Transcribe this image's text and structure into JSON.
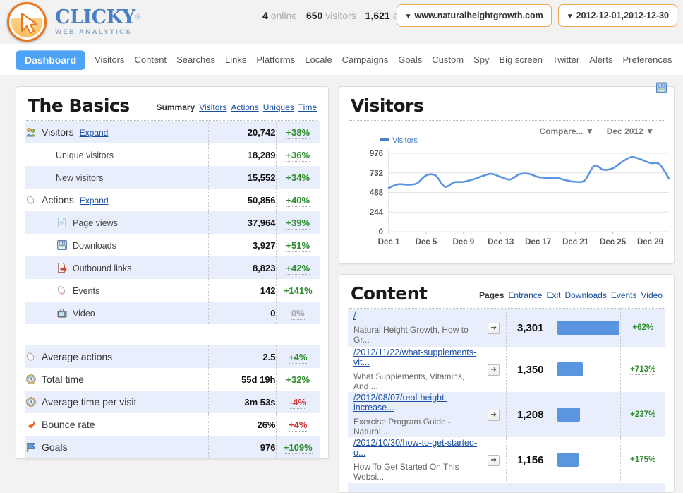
{
  "brand": {
    "name": "CLICKY",
    "reg": "®",
    "tagline": "WEB ANALYTICS",
    "logo_icon": "cursor-arrow-icon"
  },
  "header": {
    "online_count": "4",
    "online_label": "online",
    "visitors_count": "650",
    "visitors_label": "visitors",
    "actions_count": "1,621",
    "actions_label": "actions",
    "site_picker": "www.naturalheightgrowth.com",
    "date_picker": "2012-12-01,2012-12-30",
    "caret": "▼"
  },
  "nav": {
    "items": [
      {
        "label": "Dashboard",
        "active": true
      },
      {
        "label": "Visitors",
        "active": false
      },
      {
        "label": "Content",
        "active": false
      },
      {
        "label": "Searches",
        "active": false
      },
      {
        "label": "Links",
        "active": false
      },
      {
        "label": "Platforms",
        "active": false
      },
      {
        "label": "Locale",
        "active": false
      },
      {
        "label": "Campaigns",
        "active": false
      },
      {
        "label": "Goals",
        "active": false
      },
      {
        "label": "Custom",
        "active": false
      },
      {
        "label": "Spy",
        "active": false
      },
      {
        "label": "Big screen",
        "active": false
      },
      {
        "label": "Twitter",
        "active": false
      },
      {
        "label": "Alerts",
        "active": false
      },
      {
        "label": "Preferences",
        "active": false
      }
    ]
  },
  "basics": {
    "title": "The Basics",
    "tabs": [
      {
        "label": "Summary",
        "active": true
      },
      {
        "label": "Visitors",
        "active": false
      },
      {
        "label": "Actions",
        "active": false
      },
      {
        "label": "Uniques",
        "active": false
      },
      {
        "label": "Time",
        "active": false
      }
    ],
    "rows": [
      {
        "icon": "visitors-icon",
        "label": "Visitors",
        "expand": "Expand",
        "value": "20,742",
        "change": "+38%",
        "dir": "up",
        "indent": false,
        "alt": true
      },
      {
        "icon": "",
        "label": "Unique visitors",
        "expand": "",
        "value": "18,289",
        "change": "+36%",
        "dir": "up",
        "indent": true,
        "alt": false
      },
      {
        "icon": "",
        "label": "New visitors",
        "expand": "",
        "value": "15,552",
        "change": "+34%",
        "dir": "up",
        "indent": true,
        "alt": true
      },
      {
        "icon": "mouse-icon",
        "label": "Actions",
        "expand": "Expand",
        "value": "50,856",
        "change": "+40%",
        "dir": "up",
        "indent": false,
        "alt": false
      },
      {
        "icon": "page-icon",
        "label": "Page views",
        "expand": "",
        "value": "37,964",
        "change": "+39%",
        "dir": "up",
        "indent": true,
        "alt": true
      },
      {
        "icon": "floppy-icon",
        "label": "Downloads",
        "expand": "",
        "value": "3,927",
        "change": "+51%",
        "dir": "up",
        "indent": true,
        "alt": false
      },
      {
        "icon": "outbound-icon",
        "label": "Outbound links",
        "expand": "",
        "value": "8,823",
        "change": "+42%",
        "dir": "up",
        "indent": true,
        "alt": true
      },
      {
        "icon": "mouse-icon",
        "label": "Events",
        "expand": "",
        "value": "142",
        "change": "+141%",
        "dir": "up",
        "indent": true,
        "alt": false
      },
      {
        "icon": "tv-icon",
        "label": "Video",
        "expand": "",
        "value": "0",
        "change": "0%",
        "dir": "zero",
        "indent": true,
        "alt": true
      }
    ],
    "rows2": [
      {
        "icon": "mouse-icon",
        "label": "Average actions",
        "value": "2.5",
        "change": "+4%",
        "dir": "up",
        "alt": true
      },
      {
        "icon": "clock-icon",
        "label": "Total time",
        "value": "55d 19h",
        "change": "+32%",
        "dir": "up",
        "alt": false
      },
      {
        "icon": "clock-icon",
        "label": "Average time per visit",
        "value": "3m 53s",
        "change": "-4%",
        "dir": "down",
        "alt": true
      },
      {
        "icon": "bounce-icon",
        "label": "Bounce rate",
        "value": "26%",
        "change": "+4%",
        "dir": "down",
        "alt": false
      },
      {
        "icon": "flag-icon",
        "label": "Goals",
        "value": "976",
        "change": "+109%",
        "dir": "up",
        "alt": true
      }
    ]
  },
  "visitors_panel": {
    "title": "Visitors",
    "compare_label": "Compare...",
    "month_label": "Dec 2012",
    "caret": "▼",
    "save_icon": "save-floppy-icon"
  },
  "chart_data": {
    "type": "line",
    "title": "Visitors",
    "legend": [
      "Visitors"
    ],
    "legend_position": "top-left",
    "color": "#5b95e0",
    "xlabel": "",
    "ylabel": "",
    "ylim": [
      0,
      976
    ],
    "yticks": [
      0,
      244,
      488,
      732,
      976
    ],
    "ytick_labels": [
      "0",
      "244",
      "488",
      "732",
      "976"
    ],
    "grid": true,
    "xtick_labels": [
      "Dec 1",
      "Dec 5",
      "Dec 9",
      "Dec 13",
      "Dec 17",
      "Dec 21",
      "Dec 25",
      "Dec 29"
    ],
    "x": [
      "Dec 1",
      "Dec 2",
      "Dec 3",
      "Dec 4",
      "Dec 5",
      "Dec 6",
      "Dec 7",
      "Dec 8",
      "Dec 9",
      "Dec 10",
      "Dec 11",
      "Dec 12",
      "Dec 13",
      "Dec 14",
      "Dec 15",
      "Dec 16",
      "Dec 17",
      "Dec 18",
      "Dec 19",
      "Dec 20",
      "Dec 21",
      "Dec 22",
      "Dec 23",
      "Dec 24",
      "Dec 25",
      "Dec 26",
      "Dec 27",
      "Dec 28",
      "Dec 29",
      "Dec 30"
    ],
    "values": [
      545,
      590,
      585,
      600,
      700,
      700,
      560,
      615,
      620,
      650,
      690,
      720,
      680,
      650,
      715,
      720,
      680,
      670,
      670,
      640,
      620,
      640,
      820,
      770,
      790,
      870,
      930,
      900,
      855,
      840,
      660
    ],
    "series": [
      {
        "name": "Visitors",
        "values": [
          545,
          590,
          585,
          600,
          700,
          700,
          560,
          615,
          620,
          650,
          690,
          720,
          680,
          650,
          715,
          720,
          680,
          670,
          670,
          640,
          620,
          640,
          820,
          770,
          790,
          870,
          930,
          900,
          855,
          840,
          660
        ]
      }
    ]
  },
  "content_panel": {
    "title": "Content",
    "tabs": [
      {
        "label": "Pages",
        "active": true
      },
      {
        "label": "Entrance",
        "active": false
      },
      {
        "label": "Exit",
        "active": false
      },
      {
        "label": "Downloads",
        "active": false
      },
      {
        "label": "Events",
        "active": false
      },
      {
        "label": "Video",
        "active": false
      }
    ],
    "go_icon": "arrow-right-icon",
    "rows": [
      {
        "url": "/",
        "title": "Natural Height Growth, How to Gr...",
        "value": "3,301",
        "bar_pct": 100,
        "change": "+62%",
        "dir": "up",
        "alt": true
      },
      {
        "url": "/2012/11/22/what-supplements-vit...",
        "title": "What Supplements, Vitamins, And ...",
        "value": "1,350",
        "bar_pct": 41,
        "change": "+713%",
        "dir": "up",
        "alt": false
      },
      {
        "url": "/2012/08/07/real-height-increase...",
        "title": "Exercise Program Guide - Natural...",
        "value": "1,208",
        "bar_pct": 37,
        "change": "+237%",
        "dir": "up",
        "alt": true
      },
      {
        "url": "/2012/10/30/how-to-get-started-o...",
        "title": "How To Get Started On This Websi...",
        "value": "1,156",
        "bar_pct": 35,
        "change": "+175%",
        "dir": "up",
        "alt": false
      }
    ]
  }
}
